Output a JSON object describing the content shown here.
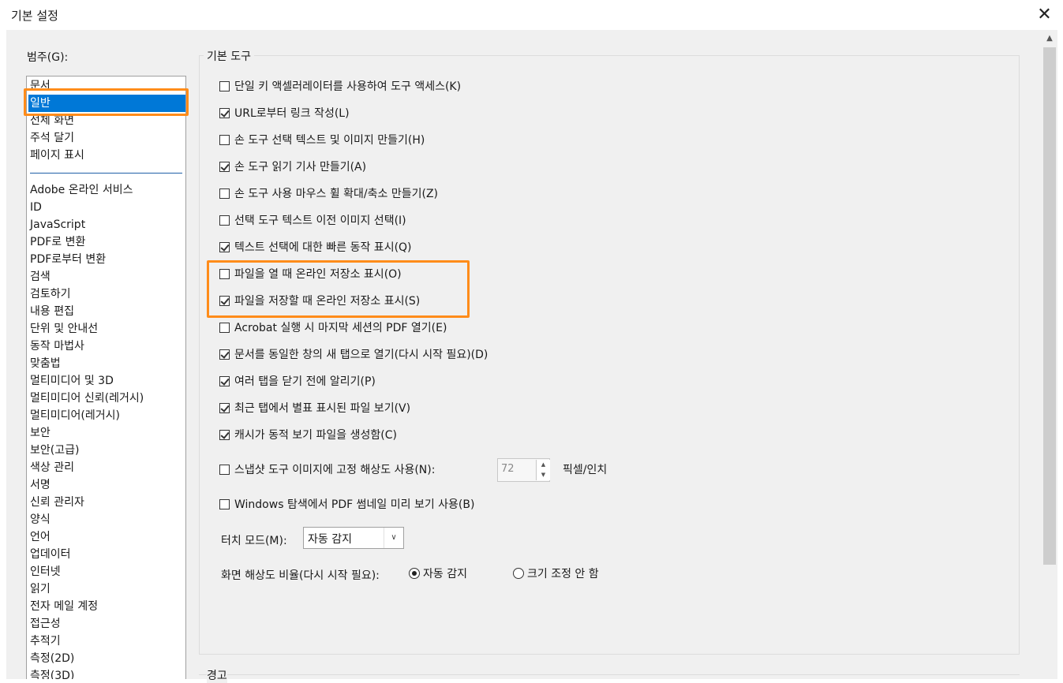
{
  "window": {
    "title": "기본 설정",
    "close_icon": "close-icon"
  },
  "categories": {
    "label": "범주(G):",
    "top_items": [
      "문서",
      "일반",
      "전체 화면",
      "주석 달기",
      "페이지 표시"
    ],
    "selected": "일반",
    "items": [
      "Adobe 온라인 서비스",
      "ID",
      "JavaScript",
      "PDF로 변환",
      "PDF로부터 변환",
      "검색",
      "검토하기",
      "내용 편집",
      "단위 및 안내선",
      "동작 마법사",
      "맞춤법",
      "멀티미디어 및 3D",
      "멀티미디어 신뢰(레거시)",
      "멀티미디어(레거시)",
      "보안",
      "보안(고급)",
      "색상 관리",
      "서명",
      "신뢰 관리자",
      "양식",
      "언어",
      "업데이터",
      "인터넷",
      "읽기",
      "전자 메일 계정",
      "접근성",
      "추적기",
      "측정(2D)",
      "측정(3D)"
    ]
  },
  "basic_tools": {
    "title": "기본 도구",
    "options": [
      {
        "label": "단일 키 액셀러레이터를 사용하여 도구 액세스(K)",
        "checked": false
      },
      {
        "label": "URL로부터 링크 작성(L)",
        "checked": true
      },
      {
        "label": "손 도구 선택 텍스트 및 이미지 만들기(H)",
        "checked": false
      },
      {
        "label": "손 도구 읽기 기사 만들기(A)",
        "checked": true
      },
      {
        "label": "손 도구 사용 마우스 휠 확대/축소 만들기(Z)",
        "checked": false
      },
      {
        "label": "선택 도구 텍스트 이전 이미지 선택(I)",
        "checked": false
      },
      {
        "label": "텍스트 선택에 대한 빠른 동작 표시(Q)",
        "checked": true
      },
      {
        "label": "파일을 열 때 온라인 저장소 표시(O)",
        "checked": false
      },
      {
        "label": "파일을 저장할 때 온라인 저장소 표시(S)",
        "checked": true
      },
      {
        "label": "Acrobat 실행 시 마지막 세션의 PDF 열기(E)",
        "checked": false
      },
      {
        "label": "문서를 동일한 창의 새 탭으로 열기(다시 시작 필요)(D)",
        "checked": true
      },
      {
        "label": "여러 탭을 닫기 전에 알리기(P)",
        "checked": true
      },
      {
        "label": "최근 탭에서 별표 표시된 파일 보기(V)",
        "checked": true
      },
      {
        "label": "캐시가 동적 보기 파일을 생성함(C)",
        "checked": true
      },
      {
        "label": "스냅샷 도구 이미지에 고정 해상도 사용(N):",
        "checked": false
      },
      {
        "label": "Windows 탐색에서 PDF 썸네일 미리 보기 사용(B)",
        "checked": false
      }
    ],
    "snapshot_resolution": "72",
    "resolution_unit": "픽셀/인치",
    "touch_mode": {
      "label": "터치 모드(M):",
      "value": "자동 감지"
    },
    "screen_scale": {
      "label": "화면 해상도 비율(다시 시작 필요):",
      "options": [
        {
          "label": "자동 감지",
          "selected": true
        },
        {
          "label": "크기 조정 안 함",
          "selected": false
        }
      ]
    }
  },
  "warnings": {
    "title": "경고"
  }
}
